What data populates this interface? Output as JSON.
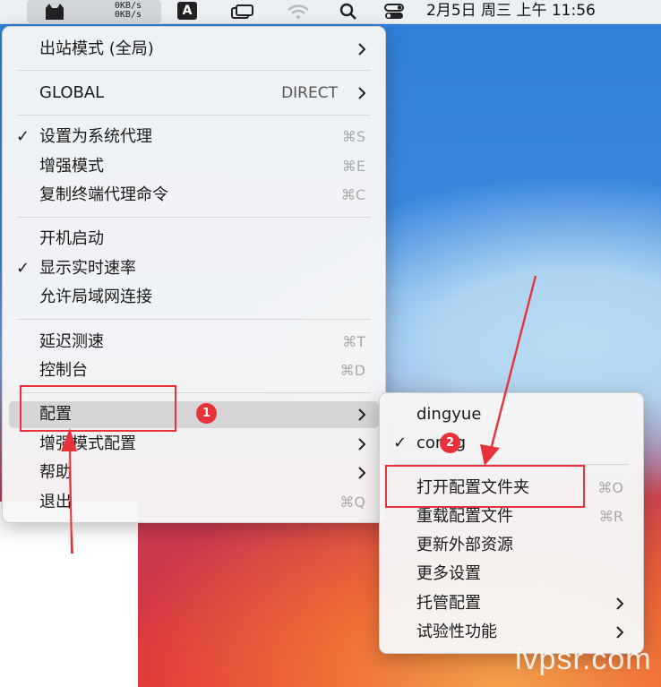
{
  "menubar": {
    "speed_up": "0KB/s",
    "speed_down": "0KB/s",
    "input_letter": "A",
    "clock": "2月5日 周三 上午 11:56"
  },
  "main_menu": {
    "outbound_mode": "出站模式 (全局)",
    "global": "GLOBAL",
    "direct": "DIRECT",
    "set_system_proxy": "设置为系统代理",
    "set_system_proxy_sc": "⌘S",
    "enhanced_mode": "增强模式",
    "enhanced_mode_sc": "⌘E",
    "copy_terminal_cmd": "复制终端代理命令",
    "copy_terminal_cmd_sc": "⌘C",
    "launch_at_login": "开机启动",
    "show_speed": "显示实时速率",
    "allow_lan": "允许局域网连接",
    "latency_test": "延迟测速",
    "latency_test_sc": "⌘T",
    "dashboard": "控制台",
    "dashboard_sc": "⌘D",
    "config": "配置",
    "enhanced_config": "增强模式配置",
    "help": "帮助",
    "quit": "退出",
    "quit_sc": "⌘Q",
    "checkmark": "✓"
  },
  "sub_menu": {
    "dingyue": "dingyue",
    "config_item": "config",
    "open_config_folder": "打开配置文件夹",
    "open_config_folder_sc": "⌘O",
    "reload_config": "重载配置文件",
    "reload_config_sc": "⌘R",
    "update_external": "更新外部资源",
    "more_settings": "更多设置",
    "managed_config": "托管配置",
    "experimental": "试验性功能",
    "checkmark": "✓"
  },
  "annotations": {
    "badge_1": "1",
    "badge_2": "2",
    "accent_color": "#e8323a"
  },
  "watermark": "ivpsr.com"
}
